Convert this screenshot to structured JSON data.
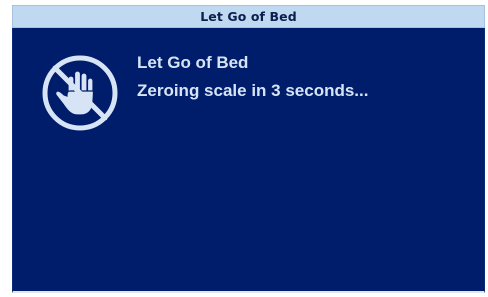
{
  "window": {
    "title": "Let Go of Bed"
  },
  "message": {
    "icon": "no-hand-icon",
    "title": "Let Go of Bed",
    "subtitle": "Zeroing scale in 3 seconds..."
  },
  "colors": {
    "titlebar_bg": "#bed9f0",
    "panel_bg": "#001d6b",
    "text": "#d7e4f6"
  }
}
